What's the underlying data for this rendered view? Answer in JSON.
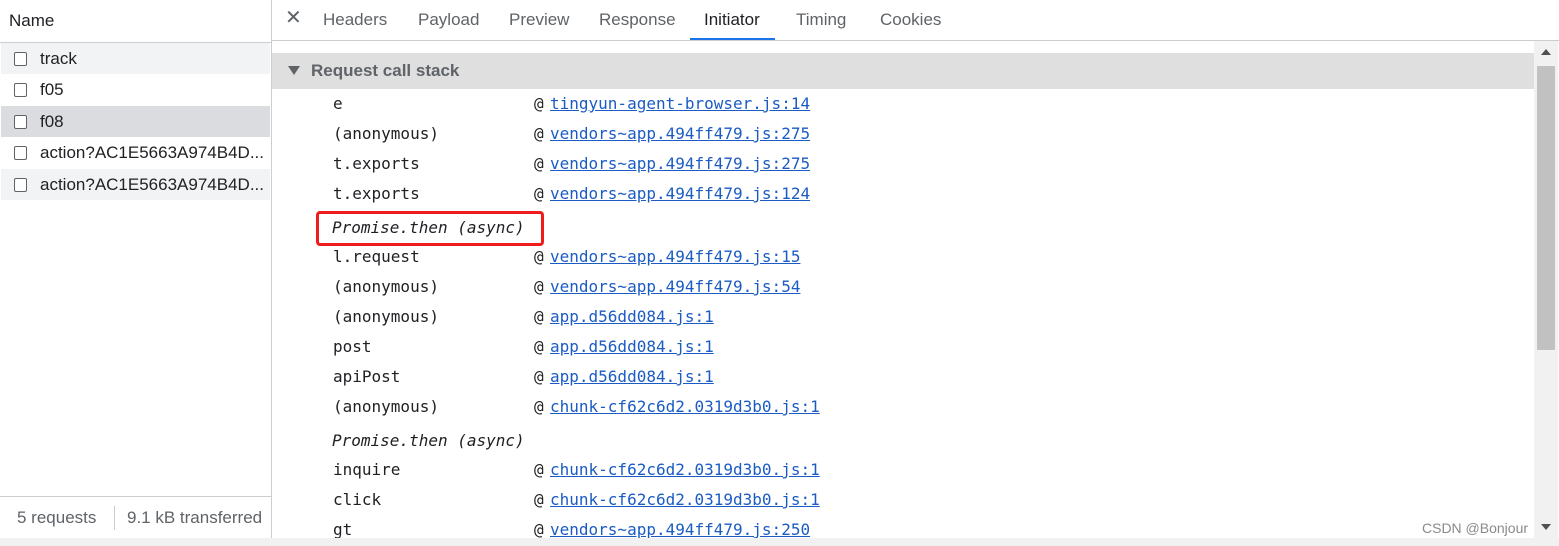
{
  "left_panel": {
    "header": "Name",
    "requests": [
      "track",
      "f05",
      "f08",
      "action?AC1E5663A974B4D...",
      "action?AC1E5663A974B4D..."
    ],
    "footer": {
      "count": "5 requests",
      "transferred": "9.1 kB transferred"
    }
  },
  "tabs": [
    "Headers",
    "Payload",
    "Preview",
    "Response",
    "Initiator",
    "Timing",
    "Cookies"
  ],
  "active_tab": "Initiator",
  "section_title": "Request call stack",
  "call_stack": {
    "group1": [
      {
        "fn": "e",
        "loc": "tingyun-agent-browser.js:14"
      },
      {
        "fn": "(anonymous)",
        "loc": "vendors~app.494ff479.js:275"
      },
      {
        "fn": "t.exports",
        "loc": "vendors~app.494ff479.js:275"
      },
      {
        "fn": "t.exports",
        "loc": "vendors~app.494ff479.js:124"
      }
    ],
    "async1": "Promise.then (async)",
    "group2": [
      {
        "fn": "l.request",
        "loc": "vendors~app.494ff479.js:15"
      },
      {
        "fn": "(anonymous)",
        "loc": "vendors~app.494ff479.js:54"
      },
      {
        "fn": "(anonymous)",
        "loc": "app.d56dd084.js:1"
      },
      {
        "fn": "post",
        "loc": "app.d56dd084.js:1"
      },
      {
        "fn": "apiPost",
        "loc": "app.d56dd084.js:1"
      },
      {
        "fn": "(anonymous)",
        "loc": "chunk-cf62c6d2.0319d3b0.js:1"
      }
    ],
    "async2": "Promise.then (async)",
    "group3": [
      {
        "fn": "inquire",
        "loc": "chunk-cf62c6d2.0319d3b0.js:1"
      },
      {
        "fn": "click",
        "loc": "chunk-cf62c6d2.0319d3b0.js:1"
      },
      {
        "fn": "gt",
        "loc": "vendors~app.494ff479.js:250"
      }
    ]
  },
  "at_symbol": "@",
  "watermark": "CSDN @Bonjour",
  "colors": {
    "link": "#1a5bc4",
    "highlight": "#ee1c1c",
    "active_tab_indicator": "#1a73e8",
    "selected_row": "#dadce0"
  },
  "icons": {
    "close": "close-icon",
    "expand": "triangle-down-icon"
  }
}
